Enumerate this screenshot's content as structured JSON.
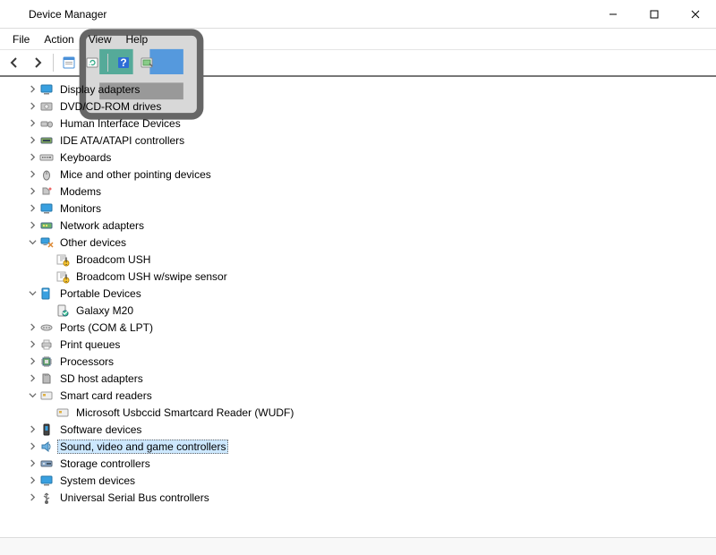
{
  "window": {
    "title": "Device Manager"
  },
  "menu": {
    "file": "File",
    "action": "Action",
    "view": "View",
    "help": "Help"
  },
  "categories": {
    "display_adapters": "Display adapters",
    "dvd": "DVD/CD-ROM drives",
    "hid": "Human Interface Devices",
    "ide": "IDE ATA/ATAPI controllers",
    "keyboards": "Keyboards",
    "mice": "Mice and other pointing devices",
    "modems": "Modems",
    "monitors": "Monitors",
    "network": "Network adapters",
    "other": "Other devices",
    "portable": "Portable Devices",
    "ports": "Ports (COM & LPT)",
    "print": "Print queues",
    "processors": "Processors",
    "sd": "SD host adapters",
    "smartcard": "Smart card readers",
    "software": "Software devices",
    "sound": "Sound, video and game controllers",
    "storage": "Storage controllers",
    "system": "System devices",
    "usb": "Universal Serial Bus controllers"
  },
  "children": {
    "broadcom_ush": "Broadcom USH",
    "broadcom_ush_swipe": "Broadcom USH w/swipe sensor",
    "galaxy_m20": "Galaxy M20",
    "ms_usbccid": "Microsoft Usbccid Smartcard Reader (WUDF)"
  }
}
